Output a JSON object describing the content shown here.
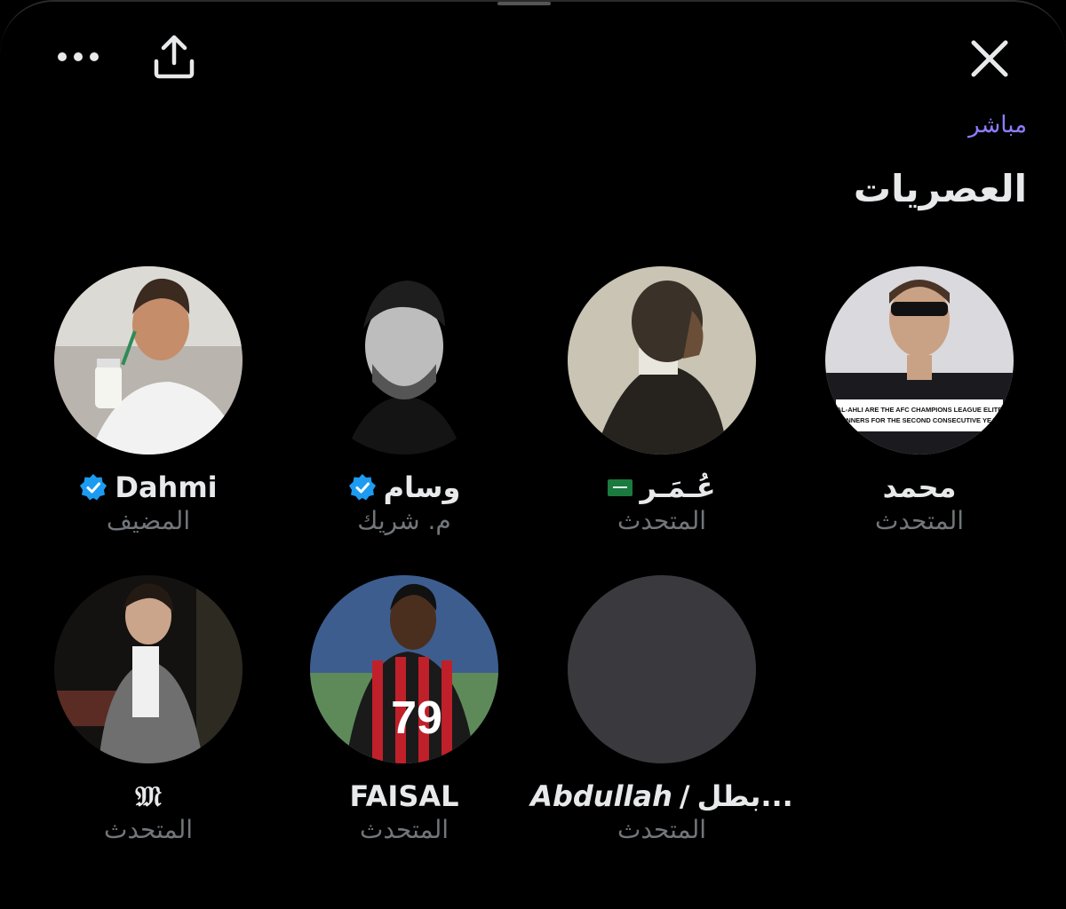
{
  "header": {
    "more_icon": "more-horizontal-icon",
    "share_icon": "share-upload-icon",
    "close_icon": "close-icon"
  },
  "space": {
    "status": "مباشر",
    "title": "العصريات"
  },
  "colors": {
    "background": "#000000",
    "live_accent": "#8c7dff",
    "verified": "#1d9bf0",
    "secondary_text": "#71767b"
  },
  "speakers": [
    {
      "name": "محمد",
      "role": "المتحدث",
      "verified": false
    },
    {
      "name": "عُـمَـر",
      "role": "المتحدث",
      "flag": "saudi-flag-icon"
    },
    {
      "name": "وسام",
      "role": "م. شريك",
      "verified": true
    },
    {
      "name": "Dahmi",
      "role": "المضيف",
      "verified": true
    },
    {
      "name": "𝔐",
      "role": "المتحدث",
      "verified": false
    },
    {
      "name": "FAISAL",
      "role": "المتحدث",
      "verified": false
    },
    {
      "name_latin": "Abdullah",
      "name_sep": "/",
      "name_arabic": "بطل...",
      "role": "المتحدث",
      "verified": false
    }
  ],
  "avatar_texts": {
    "shirt_text": "AL-AHLI ARE THE AFC CHAMPIONS LEAGUE ELITE",
    "shirt_text_2": "WINNERS FOR THE SECOND CONSECUTIVE YEAR",
    "jersey_number": "79"
  }
}
